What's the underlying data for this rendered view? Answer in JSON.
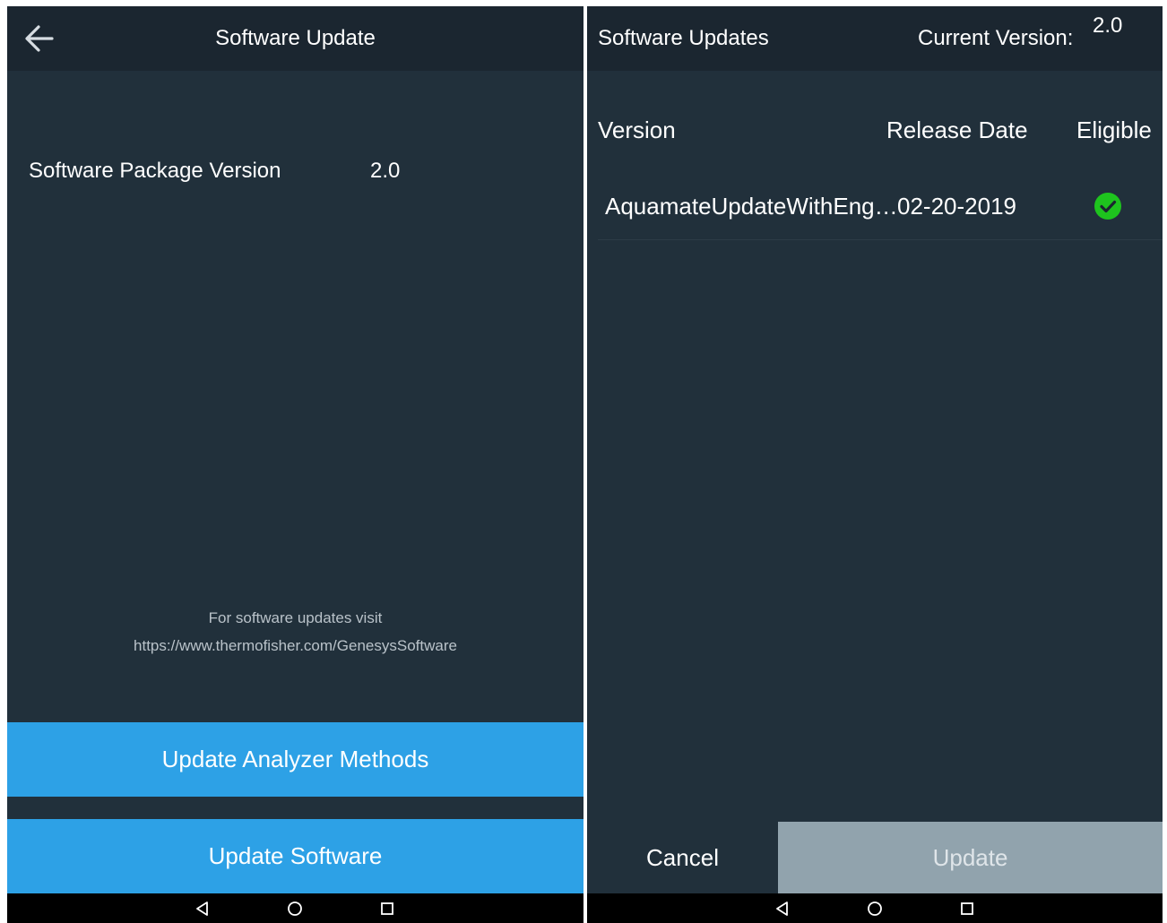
{
  "left": {
    "title": "Software Update",
    "back_icon": "arrow-left-icon",
    "package_label": "Software Package Version",
    "package_value": "2.0",
    "info_line1": "For software updates visit",
    "info_line2": "https://www.thermofisher.com/GenesysSoftware",
    "btn_methods": "Update Analyzer Methods",
    "btn_software": "Update Software"
  },
  "right": {
    "title": "Software Updates",
    "current_label": "Current Version:",
    "current_value": "2.0",
    "columns": [
      "Version",
      "Release Date",
      "Eligible"
    ],
    "rows": [
      {
        "version": "AquamateUpdateWithEng…",
        "date": "02-20-2019",
        "eligible_icon": "check-circle-icon"
      }
    ],
    "cancel": "Cancel",
    "update": "Update"
  },
  "nav_icons": [
    "back-triangle-icon",
    "home-circle-icon",
    "recents-square-icon"
  ],
  "colors": {
    "background": "#21303b",
    "appbar": "#1b2630",
    "button_blue": "#2da1e6",
    "button_disabled": "#91a3ad",
    "check_green": "#1ec41e"
  }
}
